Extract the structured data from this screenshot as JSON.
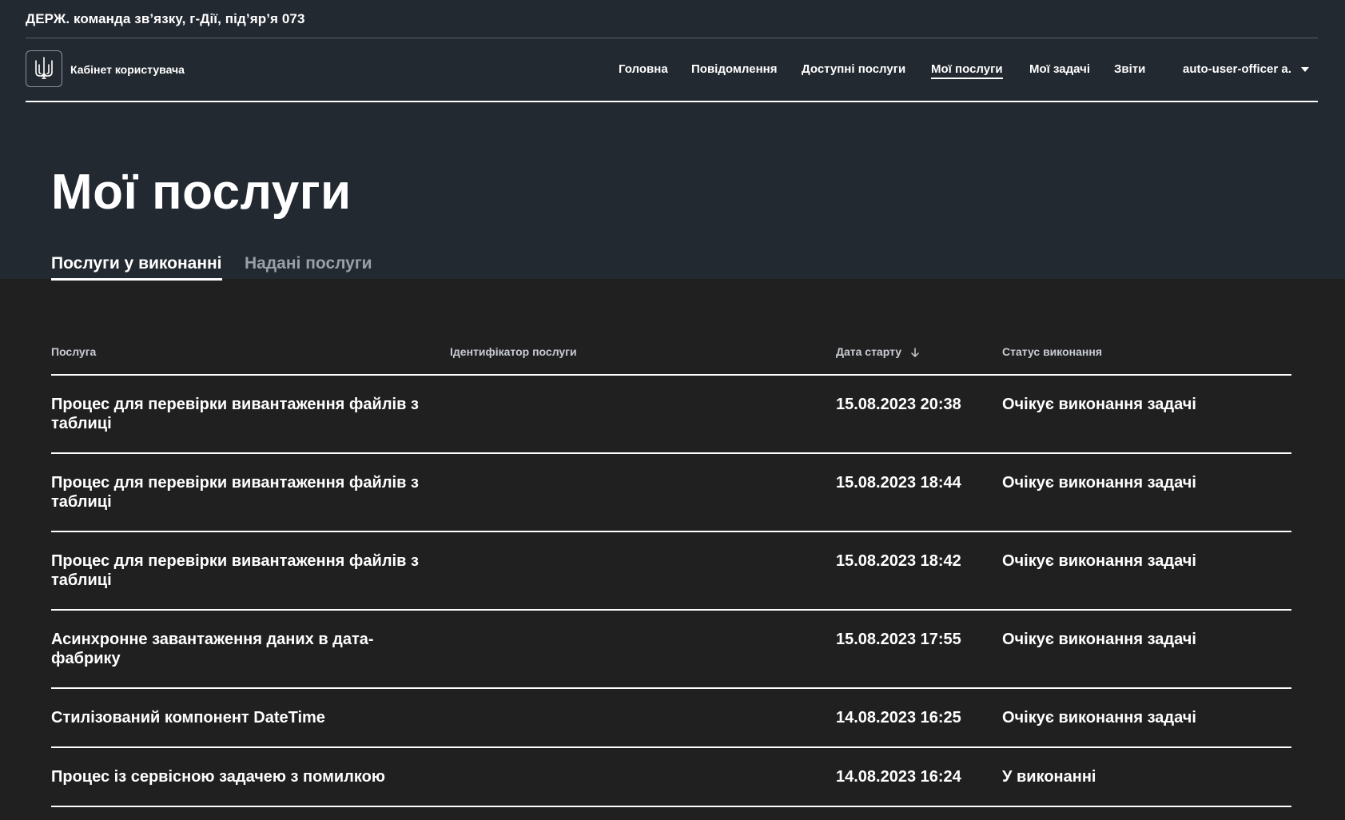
{
  "org": {
    "name": "ДЕРЖ. команда зв’язку, г-Дії, під’яр’я 073"
  },
  "header": {
    "logo_title": "Кабінет користувача",
    "nav": [
      {
        "label": "Головна",
        "active": false
      },
      {
        "label": "Повідомлення",
        "active": false
      },
      {
        "label": "Доступні послуги",
        "active": false
      },
      {
        "label": "Мої послуги",
        "active": true
      },
      {
        "label": "Мої задачі",
        "active": false
      },
      {
        "label": "Звіти",
        "active": false
      }
    ],
    "user": "auto-user-officer a."
  },
  "main": {
    "title": "Мої послуги",
    "tabs": [
      {
        "label": "Послуги у виконанні",
        "active": true
      },
      {
        "label": "Надані послуги",
        "active": false
      }
    ],
    "table": {
      "columns": [
        "Послуга",
        "Ідентифікатор послуги",
        "Дата старту",
        "Статус виконання"
      ],
      "sort_column": "Дата старту",
      "sort_direction": "descending",
      "rows": [
        {
          "service": "Процес для перевірки вивантаження файлів з таблиці",
          "id": "",
          "date": "15.08.2023 20:38",
          "status": "Очікує виконання задачі"
        },
        {
          "service": "Процес для перевірки вивантаження файлів з таблиці",
          "id": "",
          "date": "15.08.2023 18:44",
          "status": "Очікує виконання задачі"
        },
        {
          "service": "Процес для перевірки вивантаження файлів з таблиці",
          "id": "",
          "date": "15.08.2023 18:42",
          "status": "Очікує виконання задачі"
        },
        {
          "service": "Асинхронне завантаження даних в дата-фабрику",
          "id": "",
          "date": "15.08.2023 17:55",
          "status": "Очікує виконання задачі"
        },
        {
          "service": "Стилізований компонент DateTime",
          "id": "",
          "date": "14.08.2023 16:25",
          "status": "Очікує виконання задачі"
        },
        {
          "service": "Процес із сервісною задачею з помилкою",
          "id": "",
          "date": "14.08.2023 16:24",
          "status": "У виконанні"
        }
      ]
    }
  },
  "colors": {
    "header_bg": "#232931",
    "content_bg": "#202020",
    "text": "#ffffff",
    "inactive_tab": "#9aa0a8"
  },
  "icons": {
    "logo": "trident-icon",
    "user_menu": "caret-down-icon",
    "sort": "arrow-down-icon"
  }
}
